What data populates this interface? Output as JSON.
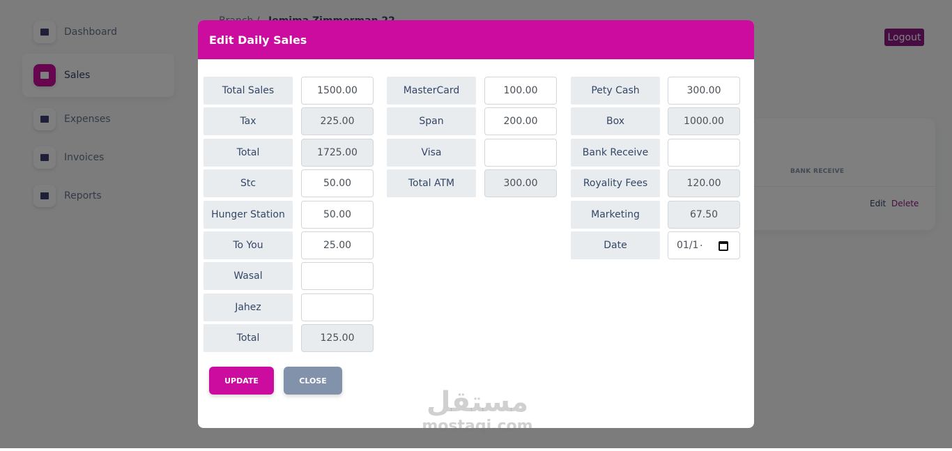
{
  "sidebar": {
    "items": [
      {
        "label": "Dashboard",
        "icon": "shop-icon",
        "active": false
      },
      {
        "label": "Sales",
        "icon": "bag-icon",
        "active": true
      },
      {
        "label": "Expenses",
        "icon": "credit-card-icon",
        "active": false
      },
      {
        "label": "Invoices",
        "icon": "box-icon",
        "active": false
      },
      {
        "label": "Reports",
        "icon": "bag-icon",
        "active": false
      }
    ]
  },
  "header": {
    "breadcrumb_root": "Branch",
    "breadcrumb_sep": "/",
    "breadcrumb_current": "Jemima Zimmerman 22",
    "logout_label": "Logout"
  },
  "card": {
    "column_header": "BANK RECEIVE",
    "edit_label": "Edit",
    "delete_label": "Delete"
  },
  "modal": {
    "title": "Edit Daily Sales",
    "col1": [
      {
        "label": "Total Sales",
        "value": "1500.00",
        "readonly": false
      },
      {
        "label": "Tax",
        "value": "225.00",
        "readonly": true
      },
      {
        "label": "Total",
        "value": "1725.00",
        "readonly": true
      },
      {
        "label": "Stc",
        "value": "50.00",
        "readonly": false
      },
      {
        "label": "Hunger Station",
        "value": "50.00",
        "readonly": false
      },
      {
        "label": "To You",
        "value": "25.00",
        "readonly": false
      },
      {
        "label": "Wasal",
        "value": "",
        "readonly": false
      },
      {
        "label": "Jahez",
        "value": "",
        "readonly": false
      },
      {
        "label": "Total",
        "value": "125.00",
        "readonly": true
      }
    ],
    "col2": [
      {
        "label": "MasterCard",
        "value": "100.00",
        "readonly": false
      },
      {
        "label": "Span",
        "value": "200.00",
        "readonly": false
      },
      {
        "label": "Visa",
        "value": "",
        "readonly": false
      },
      {
        "label": "Total ATM",
        "value": "300.00",
        "readonly": true
      }
    ],
    "col3": [
      {
        "label": "Pety Cash",
        "value": "300.00",
        "readonly": false
      },
      {
        "label": "Box",
        "value": "1000.00",
        "readonly": true
      },
      {
        "label": "Bank Receive",
        "value": "",
        "readonly": false
      },
      {
        "label": "Royality Fees",
        "value": "120.00",
        "readonly": true
      },
      {
        "label": "Marketing",
        "value": "67.50",
        "readonly": true
      }
    ],
    "date_label": "Date",
    "date_value": "01/1٠",
    "update_label": "UPDATE",
    "close_label": "CLOSE"
  },
  "watermark": {
    "arabic": "مستقل",
    "latin": "mostaqi.com"
  },
  "colors": {
    "accent": "#cb0c9f",
    "secondary": "#8392ab",
    "logout": "#8e1a86"
  }
}
